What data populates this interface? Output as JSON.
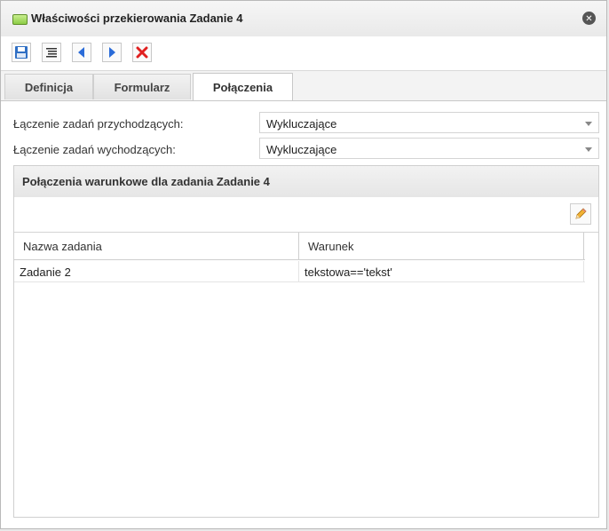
{
  "dialog": {
    "title": "Właściwości przekierowania Zadanie 4",
    "close_glyph": "✕"
  },
  "toolbar": {
    "buttons": [
      {
        "icon": "save-icon"
      },
      {
        "icon": "format-icon"
      },
      {
        "icon": "arrow-left-icon"
      },
      {
        "icon": "arrow-right-icon"
      },
      {
        "icon": "delete-icon"
      }
    ]
  },
  "tabs": [
    {
      "label": "Definicja",
      "active": false
    },
    {
      "label": "Formularz",
      "active": false
    },
    {
      "label": "Połączenia",
      "active": true
    }
  ],
  "form": {
    "incoming_label": "Łączenie zadań przychodzących:",
    "incoming_value": "Wykluczające",
    "outgoing_label": "Łączenie zadań wychodzących:",
    "outgoing_value": "Wykluczające"
  },
  "panel": {
    "title": "Połączenia warunkowe dla zadania Zadanie 4",
    "columns": [
      "Nazwa zadania",
      "Warunek"
    ],
    "rows": [
      {
        "name": "Zadanie 2",
        "condition": "tekstowa=='tekst'"
      }
    ]
  },
  "colors": {
    "delete": "#e02020",
    "arrow": "#2a6bd8",
    "save": "#2f6fc4",
    "title_icon": "#8ccc45"
  }
}
